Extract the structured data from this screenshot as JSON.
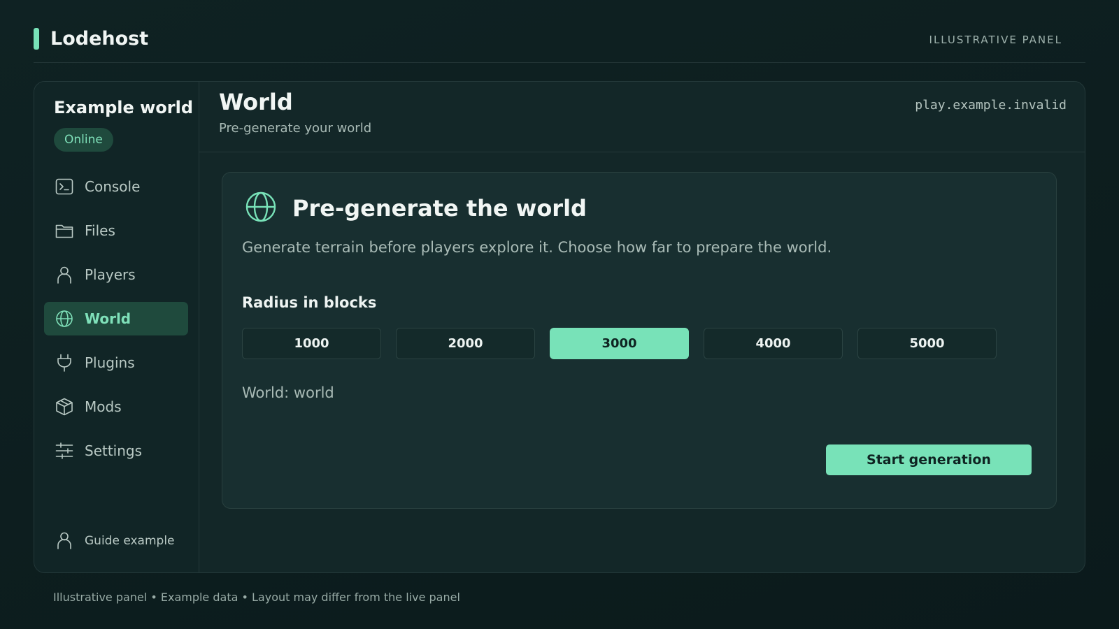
{
  "app": {
    "brand": "Lodehost",
    "tag": "ILLUSTRATIVE PANEL"
  },
  "server": {
    "name": "Example world",
    "status": "Online",
    "host": "play.example.invalid"
  },
  "sidebar": {
    "items": [
      {
        "label": "Console",
        "icon": "terminal-icon"
      },
      {
        "label": "Files",
        "icon": "folder-icon"
      },
      {
        "label": "Players",
        "icon": "user-icon"
      },
      {
        "label": "World",
        "icon": "globe-icon",
        "active": true
      },
      {
        "label": "Plugins",
        "icon": "plug-icon"
      },
      {
        "label": "Mods",
        "icon": "box-icon"
      },
      {
        "label": "Settings",
        "icon": "sliders-icon"
      }
    ],
    "user": {
      "name": "Guide example",
      "icon": "user-icon"
    }
  },
  "page": {
    "title": "World",
    "subtitle": "Pre-generate your world"
  },
  "card": {
    "icon": "globe-icon",
    "title": "Pre-generate the world",
    "description": "Generate terrain before players explore it. Choose how far to prepare the world.",
    "radius_label": "Radius in blocks",
    "radius_options": [
      "1000",
      "2000",
      "3000",
      "4000",
      "5000"
    ],
    "selected_radius": "3000",
    "world_line": "World: world",
    "start_label": "Start generation"
  },
  "footer": "Illustrative panel • Example data • Layout may differ from the live panel",
  "colors": {
    "accent": "#78e2b8",
    "background": "#0d1f20",
    "panel": "#132728",
    "active_bg": "#1f4a3d"
  }
}
